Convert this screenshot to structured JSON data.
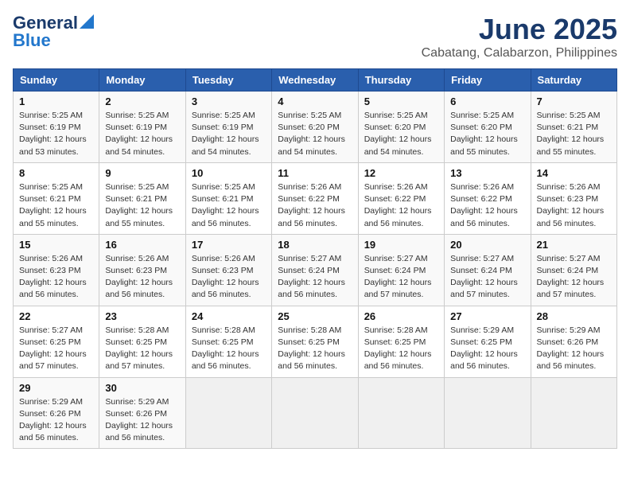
{
  "header": {
    "logo_line1": "General",
    "logo_line2": "Blue",
    "title": "June 2025",
    "subtitle": "Cabatang, Calabarzon, Philippines"
  },
  "calendar": {
    "days_of_week": [
      "Sunday",
      "Monday",
      "Tuesday",
      "Wednesday",
      "Thursday",
      "Friday",
      "Saturday"
    ],
    "weeks": [
      [
        null,
        null,
        null,
        null,
        null,
        null,
        null
      ]
    ]
  },
  "cells": [
    {
      "day": null,
      "sunrise": null,
      "sunset": null,
      "daylight": null
    },
    {
      "day": null,
      "sunrise": null,
      "sunset": null,
      "daylight": null
    },
    {
      "day": null,
      "sunrise": null,
      "sunset": null,
      "daylight": null
    },
    {
      "day": null,
      "sunrise": null,
      "sunset": null,
      "daylight": null
    },
    {
      "day": null,
      "sunrise": null,
      "sunset": null,
      "daylight": null
    },
    {
      "day": null,
      "sunrise": null,
      "sunset": null,
      "daylight": null
    },
    {
      "day": null,
      "sunrise": null,
      "sunset": null,
      "daylight": null
    }
  ],
  "weeks": [
    [
      {
        "day": "1",
        "lines": [
          "Sunrise: 5:25 AM",
          "Sunset: 6:19 PM",
          "Daylight: 12 hours",
          "and 53 minutes."
        ]
      },
      {
        "day": "2",
        "lines": [
          "Sunrise: 5:25 AM",
          "Sunset: 6:19 PM",
          "Daylight: 12 hours",
          "and 54 minutes."
        ]
      },
      {
        "day": "3",
        "lines": [
          "Sunrise: 5:25 AM",
          "Sunset: 6:19 PM",
          "Daylight: 12 hours",
          "and 54 minutes."
        ]
      },
      {
        "day": "4",
        "lines": [
          "Sunrise: 5:25 AM",
          "Sunset: 6:20 PM",
          "Daylight: 12 hours",
          "and 54 minutes."
        ]
      },
      {
        "day": "5",
        "lines": [
          "Sunrise: 5:25 AM",
          "Sunset: 6:20 PM",
          "Daylight: 12 hours",
          "and 54 minutes."
        ]
      },
      {
        "day": "6",
        "lines": [
          "Sunrise: 5:25 AM",
          "Sunset: 6:20 PM",
          "Daylight: 12 hours",
          "and 55 minutes."
        ]
      },
      {
        "day": "7",
        "lines": [
          "Sunrise: 5:25 AM",
          "Sunset: 6:21 PM",
          "Daylight: 12 hours",
          "and 55 minutes."
        ]
      }
    ],
    [
      {
        "day": "8",
        "lines": [
          "Sunrise: 5:25 AM",
          "Sunset: 6:21 PM",
          "Daylight: 12 hours",
          "and 55 minutes."
        ]
      },
      {
        "day": "9",
        "lines": [
          "Sunrise: 5:25 AM",
          "Sunset: 6:21 PM",
          "Daylight: 12 hours",
          "and 55 minutes."
        ]
      },
      {
        "day": "10",
        "lines": [
          "Sunrise: 5:25 AM",
          "Sunset: 6:21 PM",
          "Daylight: 12 hours",
          "and 56 minutes."
        ]
      },
      {
        "day": "11",
        "lines": [
          "Sunrise: 5:26 AM",
          "Sunset: 6:22 PM",
          "Daylight: 12 hours",
          "and 56 minutes."
        ]
      },
      {
        "day": "12",
        "lines": [
          "Sunrise: 5:26 AM",
          "Sunset: 6:22 PM",
          "Daylight: 12 hours",
          "and 56 minutes."
        ]
      },
      {
        "day": "13",
        "lines": [
          "Sunrise: 5:26 AM",
          "Sunset: 6:22 PM",
          "Daylight: 12 hours",
          "and 56 minutes."
        ]
      },
      {
        "day": "14",
        "lines": [
          "Sunrise: 5:26 AM",
          "Sunset: 6:23 PM",
          "Daylight: 12 hours",
          "and 56 minutes."
        ]
      }
    ],
    [
      {
        "day": "15",
        "lines": [
          "Sunrise: 5:26 AM",
          "Sunset: 6:23 PM",
          "Daylight: 12 hours",
          "and 56 minutes."
        ]
      },
      {
        "day": "16",
        "lines": [
          "Sunrise: 5:26 AM",
          "Sunset: 6:23 PM",
          "Daylight: 12 hours",
          "and 56 minutes."
        ]
      },
      {
        "day": "17",
        "lines": [
          "Sunrise: 5:26 AM",
          "Sunset: 6:23 PM",
          "Daylight: 12 hours",
          "and 56 minutes."
        ]
      },
      {
        "day": "18",
        "lines": [
          "Sunrise: 5:27 AM",
          "Sunset: 6:24 PM",
          "Daylight: 12 hours",
          "and 56 minutes."
        ]
      },
      {
        "day": "19",
        "lines": [
          "Sunrise: 5:27 AM",
          "Sunset: 6:24 PM",
          "Daylight: 12 hours",
          "and 57 minutes."
        ]
      },
      {
        "day": "20",
        "lines": [
          "Sunrise: 5:27 AM",
          "Sunset: 6:24 PM",
          "Daylight: 12 hours",
          "and 57 minutes."
        ]
      },
      {
        "day": "21",
        "lines": [
          "Sunrise: 5:27 AM",
          "Sunset: 6:24 PM",
          "Daylight: 12 hours",
          "and 57 minutes."
        ]
      }
    ],
    [
      {
        "day": "22",
        "lines": [
          "Sunrise: 5:27 AM",
          "Sunset: 6:25 PM",
          "Daylight: 12 hours",
          "and 57 minutes."
        ]
      },
      {
        "day": "23",
        "lines": [
          "Sunrise: 5:28 AM",
          "Sunset: 6:25 PM",
          "Daylight: 12 hours",
          "and 57 minutes."
        ]
      },
      {
        "day": "24",
        "lines": [
          "Sunrise: 5:28 AM",
          "Sunset: 6:25 PM",
          "Daylight: 12 hours",
          "and 56 minutes."
        ]
      },
      {
        "day": "25",
        "lines": [
          "Sunrise: 5:28 AM",
          "Sunset: 6:25 PM",
          "Daylight: 12 hours",
          "and 56 minutes."
        ]
      },
      {
        "day": "26",
        "lines": [
          "Sunrise: 5:28 AM",
          "Sunset: 6:25 PM",
          "Daylight: 12 hours",
          "and 56 minutes."
        ]
      },
      {
        "day": "27",
        "lines": [
          "Sunrise: 5:29 AM",
          "Sunset: 6:25 PM",
          "Daylight: 12 hours",
          "and 56 minutes."
        ]
      },
      {
        "day": "28",
        "lines": [
          "Sunrise: 5:29 AM",
          "Sunset: 6:26 PM",
          "Daylight: 12 hours",
          "and 56 minutes."
        ]
      }
    ],
    [
      {
        "day": "29",
        "lines": [
          "Sunrise: 5:29 AM",
          "Sunset: 6:26 PM",
          "Daylight: 12 hours",
          "and 56 minutes."
        ]
      },
      {
        "day": "30",
        "lines": [
          "Sunrise: 5:29 AM",
          "Sunset: 6:26 PM",
          "Daylight: 12 hours",
          "and 56 minutes."
        ]
      },
      null,
      null,
      null,
      null,
      null
    ]
  ]
}
